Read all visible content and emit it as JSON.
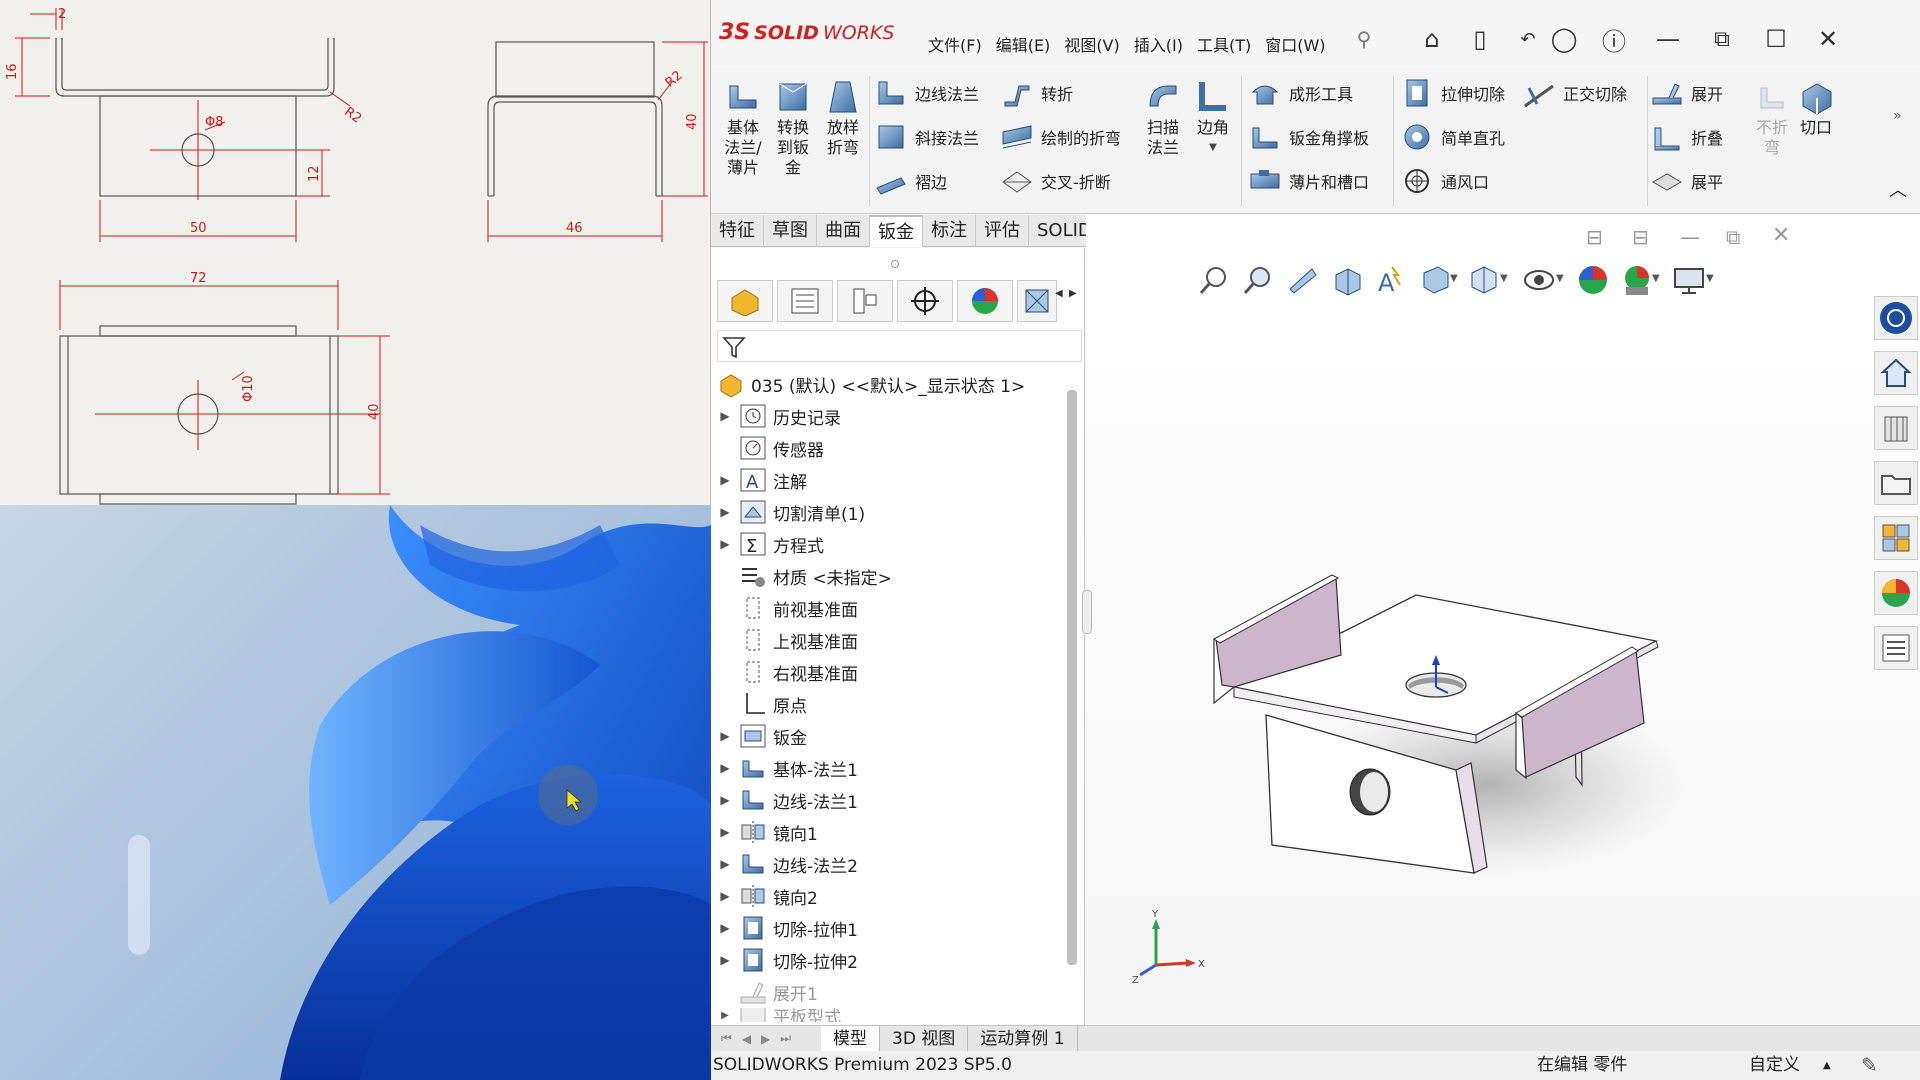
{
  "drawing": {
    "dims": {
      "d_top": "2",
      "d_16": "16",
      "d_R2a": "R2",
      "d_phi8": "Φ8",
      "d_12": "12",
      "d_50": "50",
      "d_R2b": "R2",
      "d_40a": "40",
      "d_46": "46",
      "d_72": "72",
      "d_phi10": "Φ10",
      "d_40b": "40"
    }
  },
  "app": {
    "logo_ds": "3S",
    "logo_solid": "SOLID",
    "logo_works": "WORKS",
    "menus": [
      "文件(F)",
      "编辑(E)",
      "视图(V)",
      "插入(I)",
      "工具(T)",
      "窗口(W)"
    ]
  },
  "ribbon": {
    "base_flange": [
      "基体",
      "法兰/",
      "薄片"
    ],
    "convert": [
      "转换",
      "到钣",
      "金"
    ],
    "loft": [
      "放样",
      "折弯"
    ],
    "edge_flange": "边线法兰",
    "miter_flange": "斜接法兰",
    "hem": "褶边",
    "jog": "转折",
    "sketched_bend": "绘制的折弯",
    "cross_break": "交叉-折断",
    "swept": [
      "扫描",
      "法兰"
    ],
    "corner": "边角",
    "forming": "成形工具",
    "gusset": "钣金角撑板",
    "tab_slot": "薄片和槽口",
    "extruded_cut": "拉伸切除",
    "simple_hole": "简单直孔",
    "vent": "通风口",
    "normal_cut": "正交切除",
    "unfold": "展开",
    "fold": "折叠",
    "flatten": "展平",
    "no_bends": [
      "不折",
      "弯"
    ],
    "rip": "切口"
  },
  "cmdtabs": [
    "特征",
    "草图",
    "曲面",
    "钣金",
    "标注",
    "评估",
    "SOLIDWORKS 插件"
  ],
  "tree": {
    "root": "035 (默认) <<默认>_显示状态 1>",
    "items": [
      "历史记录",
      "传感器",
      "注解",
      "切割清单(1)",
      "方程式",
      "材质 <未指定>",
      "前视基准面",
      "上视基准面",
      "右视基准面",
      "原点",
      "钣金",
      "基体-法兰1",
      "边线-法兰1",
      "镜向1",
      "边线-法兰2",
      "镜向2",
      "切除-拉伸1",
      "切除-拉伸2",
      "展开1",
      "平板型式"
    ]
  },
  "bottom_tabs": [
    "模型",
    "3D 视图",
    "运动算例 1"
  ],
  "status": {
    "version": "SOLIDWORKS Premium 2023 SP5.0",
    "editing": "在编辑 零件",
    "custom": "自定义"
  },
  "triad": {
    "x": "X",
    "y": "Y",
    "z": "Z"
  },
  "colors": {
    "accent": "#d0201c",
    "dim": "#d01818"
  }
}
